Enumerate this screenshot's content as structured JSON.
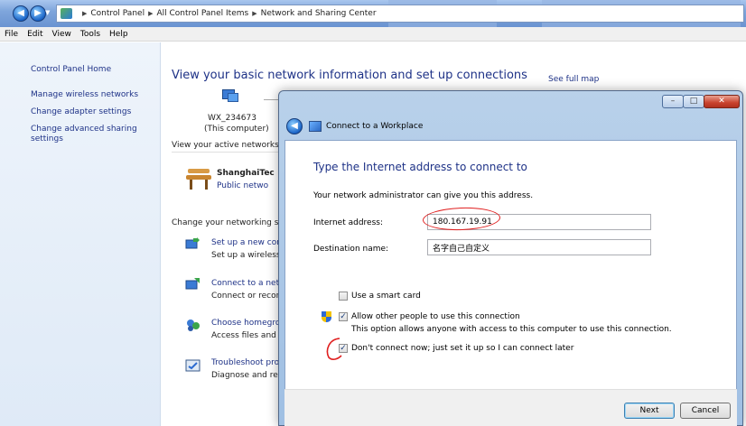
{
  "window": {
    "breadcrumbs": [
      "Control Panel",
      "All Control Panel Items",
      "Network and Sharing Center"
    ],
    "menu": [
      "File",
      "Edit",
      "View",
      "Tools",
      "Help"
    ]
  },
  "sidebar": {
    "home": "Control Panel Home",
    "links": [
      "Manage wireless networks",
      "Change adapter settings",
      "Change advanced sharing",
      "settings"
    ]
  },
  "main": {
    "title": "View your basic network information and set up connections",
    "computer_name": "WX_234673",
    "computer_sub": "(This computer)",
    "see_full_map": "See full map",
    "active_networks_label": "View your active networks",
    "network_name": "ShanghaiTec",
    "network_type": "Public netwo",
    "change_settings_label": "Change your networking se",
    "tasks": [
      {
        "link": "Set up a new con",
        "desc": "Set up a wireless,"
      },
      {
        "link": "Connect to a netw",
        "desc": "Connect or recon"
      },
      {
        "link": "Choose homegro",
        "desc": "Access files and p"
      },
      {
        "link": "Troubleshoot pro",
        "desc": "Diagnose and rep"
      }
    ]
  },
  "dialog": {
    "title": "Connect to a Workplace",
    "heading": "Type the Internet address to connect to",
    "description": "Your network administrator can give you this address.",
    "internet_address_label": "Internet address:",
    "internet_address_value": "180.167.19.91",
    "destination_label": "Destination name:",
    "destination_value": "名字自己自定义",
    "smart_card_label": "Use a smart card",
    "smart_card_checked": false,
    "allow_others_label": "Allow other people to use this connection",
    "allow_others_checked": true,
    "allow_others_note": "This option allows anyone with access to this computer to use this connection.",
    "dont_connect_label": "Don't connect now; just set it up so I can connect later",
    "dont_connect_checked": true,
    "next_button": "Next",
    "cancel_button": "Cancel",
    "check_mark": "✓",
    "close_glyph": "✕",
    "minimize_glyph": "–",
    "maximize_glyph": "□",
    "back_glyph": "◀"
  },
  "colors": {
    "link": "#1e3287",
    "annotation": "#e02020"
  }
}
